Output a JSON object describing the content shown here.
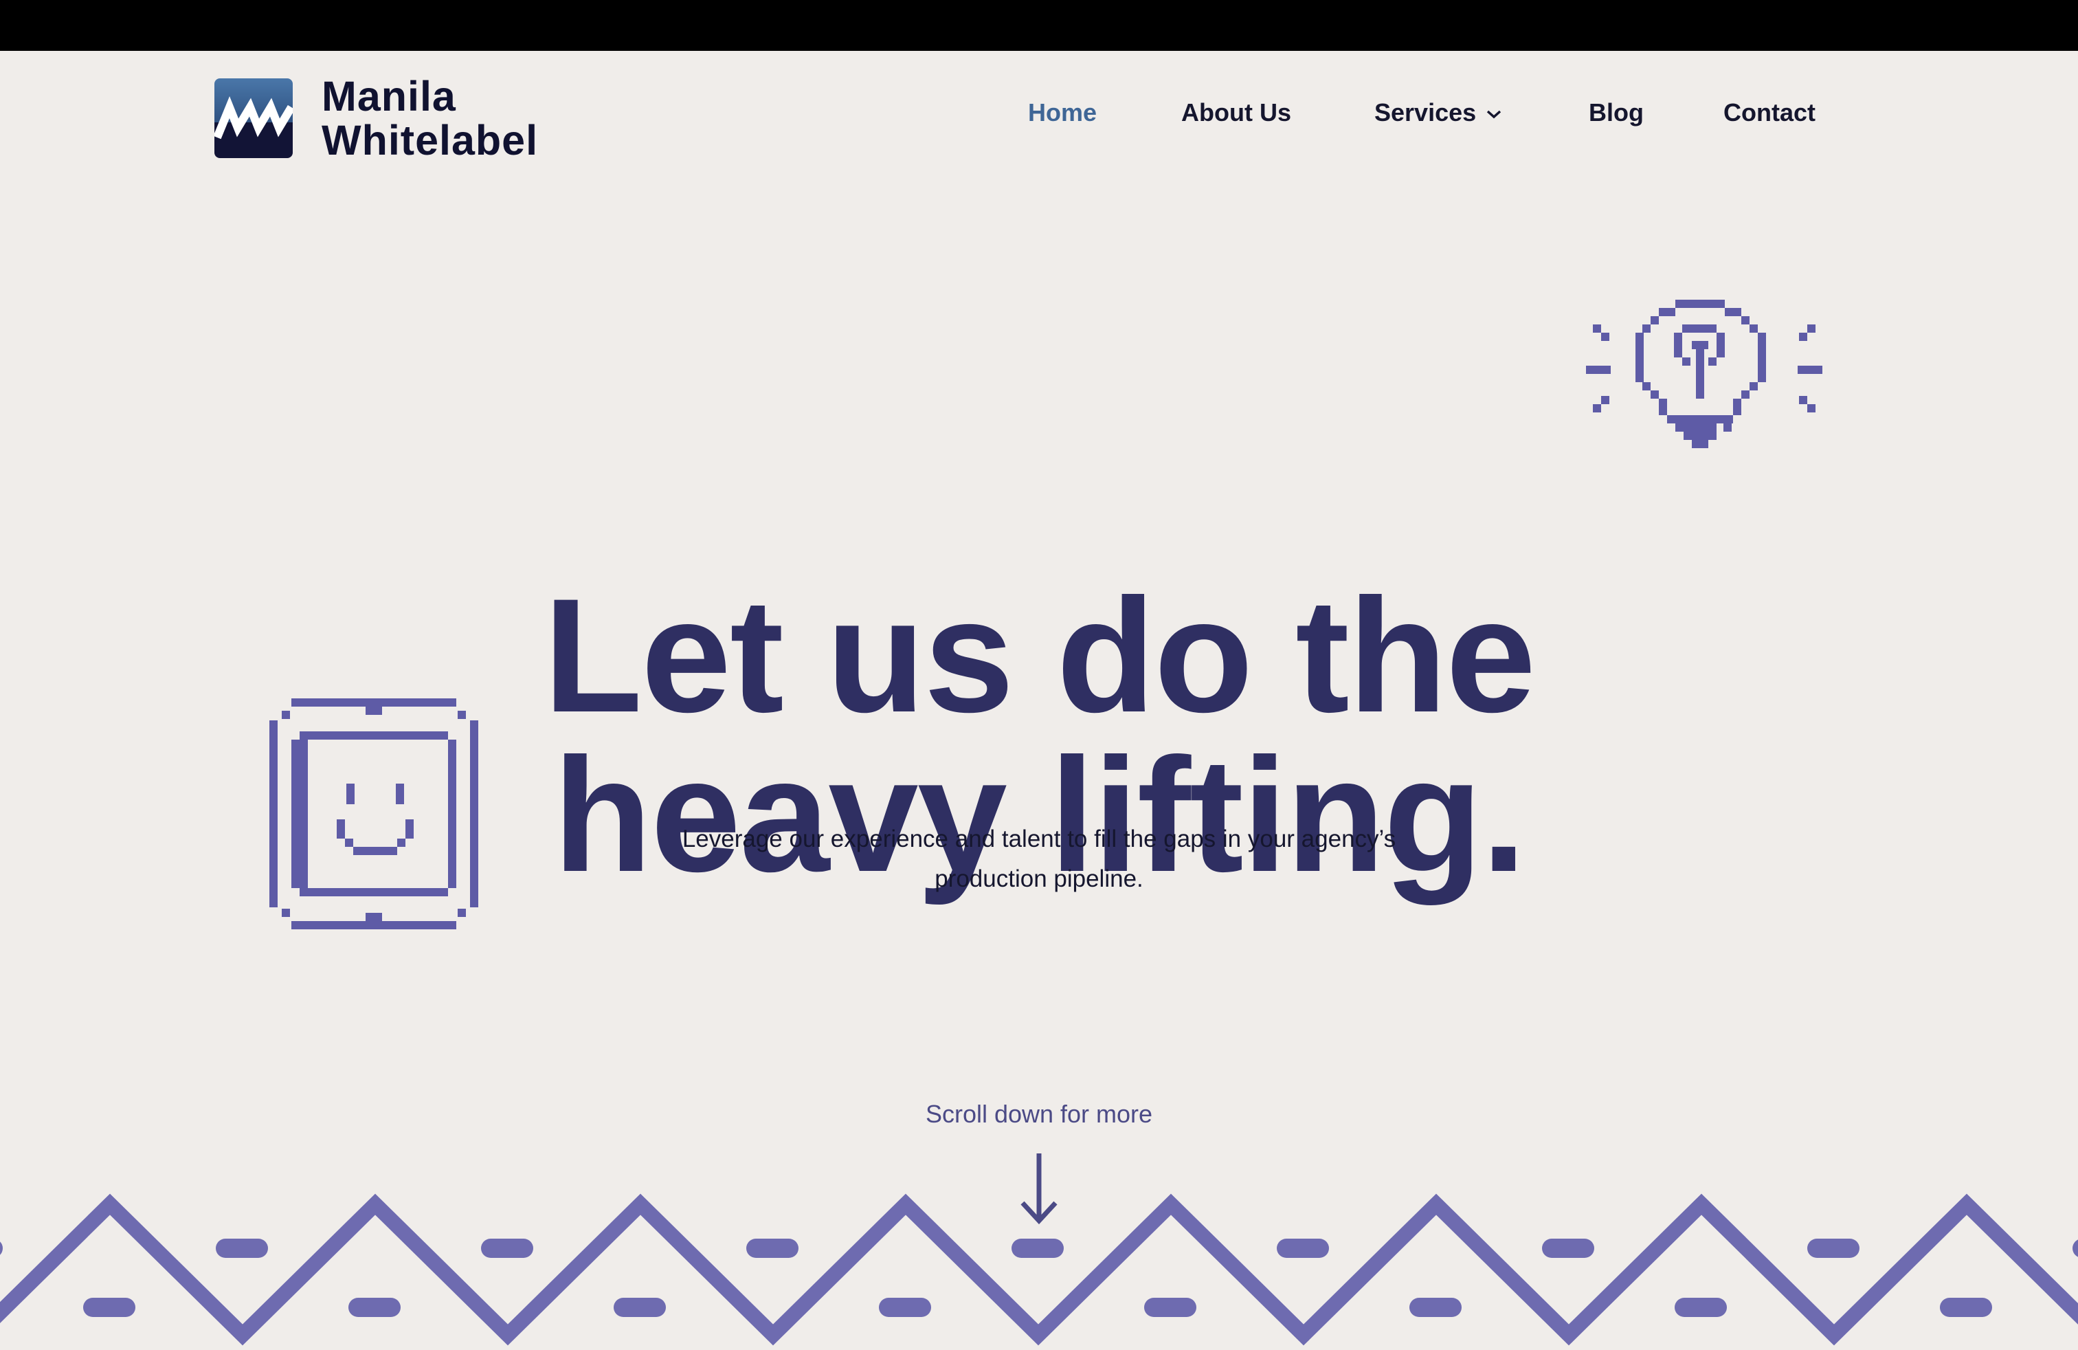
{
  "header": {
    "logo": {
      "line1": "Manila",
      "line2": "Whitelabel"
    },
    "nav": {
      "home": "Home",
      "about": "About Us",
      "services": "Services",
      "blog": "Blog",
      "contact": "Contact"
    },
    "active_item": "Home"
  },
  "hero": {
    "title_line1": "Let us do the",
    "title_line2": "heavy lifting.",
    "subtitle_line1": "Leverage our experience and talent to fill the gaps in your agency’s",
    "subtitle_line2": "production pipeline."
  },
  "scroll_hint": "Scroll down for more",
  "icons": {
    "logo": "manila-whitelabel-logo-icon",
    "services_dropdown": "chevron-down-icon",
    "scroll": "arrow-down-icon",
    "bulb": "pixel-lightbulb-icon",
    "smiley": "pixel-smiley-face-icon",
    "pattern": "zigzag-pattern"
  },
  "colors": {
    "background": "#f0edea",
    "topbar": "#000000",
    "title": "#2f2f62",
    "active_nav": "#3f6696",
    "accent": "#6e6bb0",
    "text": "#15162e"
  }
}
